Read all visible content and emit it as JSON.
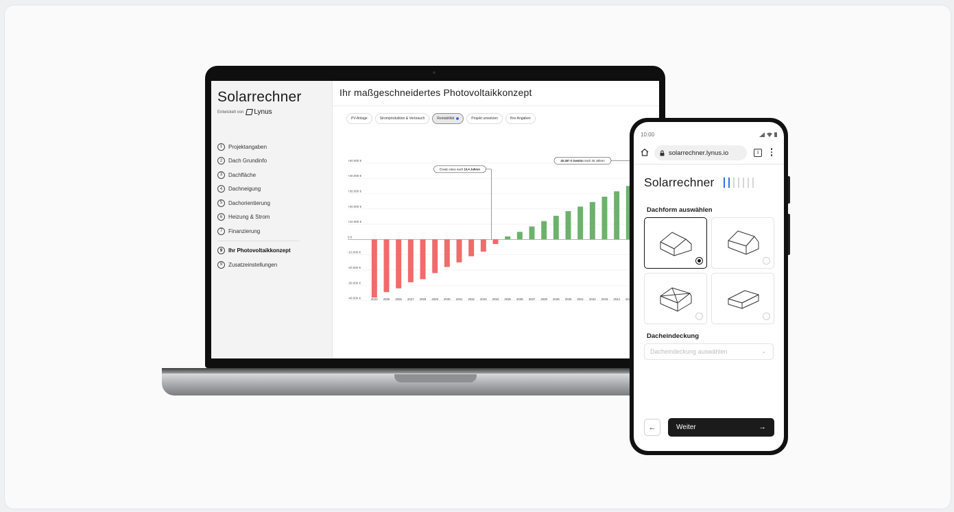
{
  "laptop": {
    "sidebar": {
      "brand": "Solarrechner",
      "developed_by": "Entwickelt von",
      "company": "Lynus",
      "steps": [
        {
          "num": "1",
          "label": "Projektangaben"
        },
        {
          "num": "2",
          "label": "Dach Grundinfo"
        },
        {
          "num": "3",
          "label": "Dachfläche"
        },
        {
          "num": "4",
          "label": "Dachneigung"
        },
        {
          "num": "5",
          "label": "Dachorientierung"
        },
        {
          "num": "6",
          "label": "Heizung & Strom"
        },
        {
          "num": "7",
          "label": "Finanzierung"
        }
      ],
      "steps_extra": [
        {
          "num": "9",
          "label": "Ihr Photovoltaikkonzept",
          "active": true
        },
        {
          "num": "9",
          "label": "Zusatzeinstellungen"
        }
      ]
    },
    "main": {
      "title": "Ihr maßgeschneidertes Photovoltaikkonzept",
      "tabs": [
        "PV-Anlage",
        "Stromproduktion & Verbrauch",
        "Rentabilität",
        "Projekt umsetzen",
        "Ihre Angaben"
      ],
      "active_tab": "Rentabilität",
      "accent": "#2f6fe0"
    }
  },
  "chart_data": {
    "type": "bar",
    "categories": [
      "2024",
      "2025",
      "2026",
      "2027",
      "2028",
      "2029",
      "2030",
      "2031",
      "2032",
      "2033",
      "2034",
      "2035",
      "2036",
      "2037",
      "2038",
      "2039",
      "2040",
      "2041",
      "2042",
      "2043",
      "2044",
      "2045",
      "2046",
      "2047"
    ],
    "category_labels": [
      "2024",
      "2025",
      "2026",
      "2027",
      "2028",
      "2029",
      "2030",
      "2031",
      "2032",
      "2033",
      "2034",
      "2035",
      "2036",
      "2037",
      "2038",
      "2039",
      "2040",
      "2041",
      "2042",
      "2043",
      "2044",
      "2045",
      "2046",
      "20"
    ],
    "values": [
      -38000,
      -34500,
      -32000,
      -28000,
      -26000,
      -22000,
      -18000,
      -15000,
      -11000,
      -8000,
      -3000,
      2000,
      5000,
      8500,
      12000,
      15500,
      18500,
      21500,
      24500,
      28000,
      31500,
      35000,
      40000,
      44000
    ],
    "yticks": [
      "+50.000 €",
      "+40.000 €",
      "+30.000 €",
      "+20.000 €",
      "+10.000 €",
      "0 €",
      "-10.000 €",
      "-20.000 €",
      "-30.000 €",
      "-40.000 €"
    ],
    "ytick_values": [
      50000,
      40000,
      30000,
      20000,
      10000,
      0,
      -10000,
      -20000,
      -30000,
      -40000
    ],
    "ylim": [
      -42000,
      54000
    ],
    "colors": {
      "negative": "#f06b6b",
      "positive": "#6db26b"
    },
    "annotations": {
      "breakeven_prefix": "Ersatz eines nach",
      "breakeven_bold": "10,4 Jahren",
      "breakeven_year": "2034",
      "profit_bold": "40.457 € Gewinn",
      "profit_suffix": "nach 25 Jahren",
      "profit_value": 40457
    }
  },
  "phone": {
    "time": "10:00",
    "url": "solarrechner.lynus.io",
    "tab_count": "1",
    "brand": "Solarrechner",
    "progress_total": 7,
    "progress_done": 2,
    "roof_title": "Dachform auswählen",
    "roof_options": [
      "satteldach-icon",
      "walmdach-icon",
      "zeltdach-icon",
      "pultdach-icon"
    ],
    "selected_roof": 0,
    "covering_title": "Dacheindeckung",
    "covering_placeholder": "Dacheindeckung auswählen",
    "next_label": "Weiter"
  }
}
